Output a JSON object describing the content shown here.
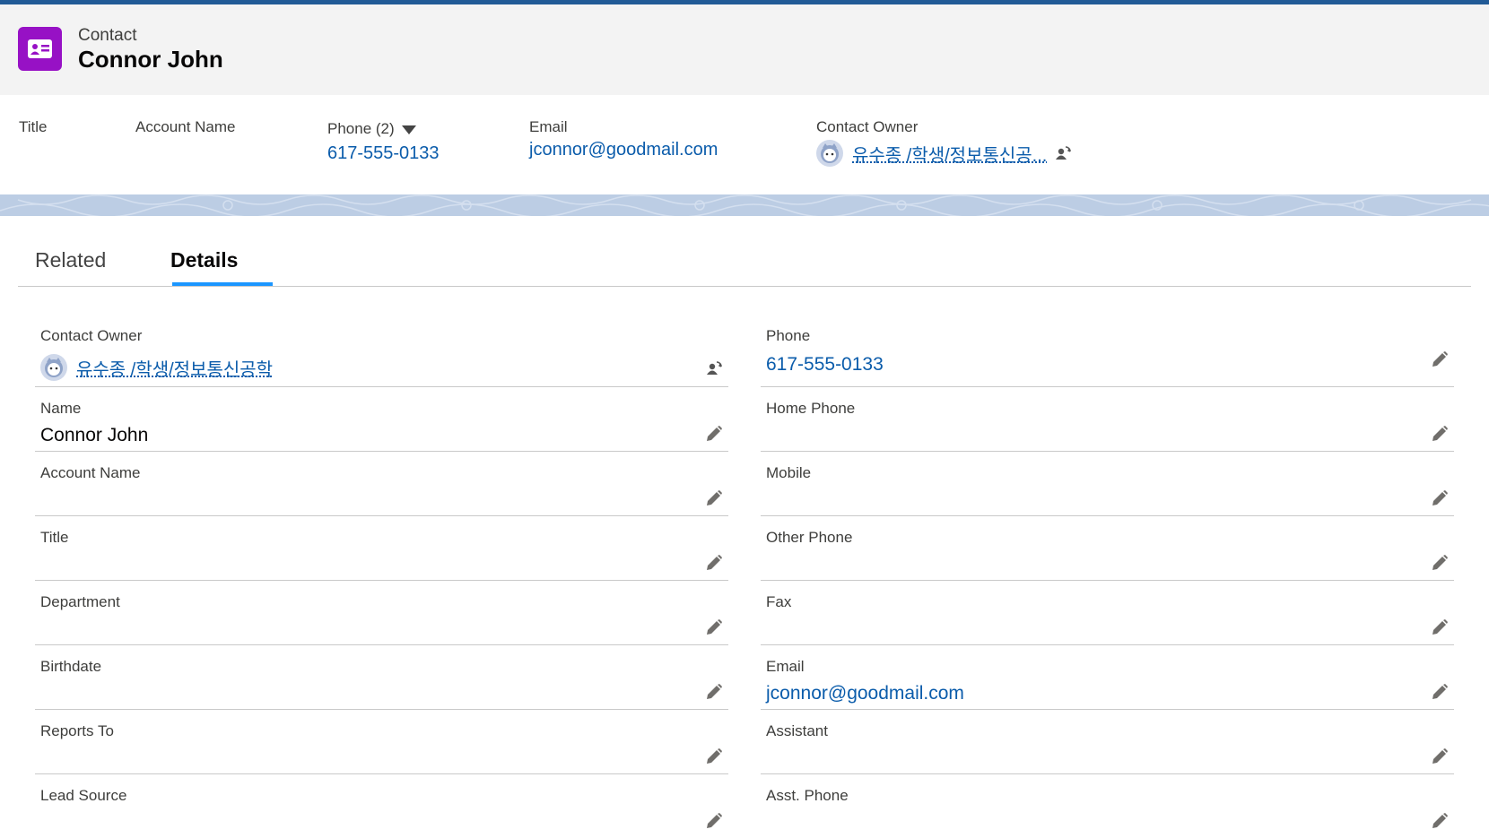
{
  "header": {
    "object_type": "Contact",
    "record_name": "Connor John"
  },
  "highlights": {
    "title_label": "Title",
    "account_label": "Account Name",
    "phone_label": "Phone (2)",
    "phone_value": "617-555-0133",
    "email_label": "Email",
    "email_value": "jconnor@goodmail.com",
    "owner_label": "Contact Owner",
    "owner_value": "유수종 /학생/정보통신공..."
  },
  "tabs": [
    {
      "label": "Related"
    },
    {
      "label": "Details"
    }
  ],
  "details": {
    "left": [
      {
        "label": "Contact Owner",
        "value": "유수종 /학생/정보통신공학"
      },
      {
        "label": "Name",
        "value": "Connor John"
      },
      {
        "label": "Account Name",
        "value": ""
      },
      {
        "label": "Title",
        "value": ""
      },
      {
        "label": "Department",
        "value": ""
      },
      {
        "label": "Birthdate",
        "value": ""
      },
      {
        "label": "Reports To",
        "value": ""
      },
      {
        "label": "Lead Source",
        "value": ""
      }
    ],
    "right": [
      {
        "label": "Phone",
        "value": "617-555-0133"
      },
      {
        "label": "Home Phone",
        "value": ""
      },
      {
        "label": "Mobile",
        "value": ""
      },
      {
        "label": "Other Phone",
        "value": ""
      },
      {
        "label": "Fax",
        "value": ""
      },
      {
        "label": "Email",
        "value": "jconnor@goodmail.com"
      },
      {
        "label": "Assistant",
        "value": ""
      },
      {
        "label": "Asst. Phone",
        "value": ""
      }
    ]
  },
  "colors": {
    "brand_bar": "#215a96",
    "contact_icon": "#9711c5",
    "link": "#0b5cab",
    "active_tab": "#1b96ff"
  },
  "icons": {
    "contact": "contact-card-icon",
    "owner_avatar": "avatar-icon",
    "change_owner": "change-owner-icon",
    "edit": "pencil-icon",
    "dropdown": "caret-down-icon"
  }
}
